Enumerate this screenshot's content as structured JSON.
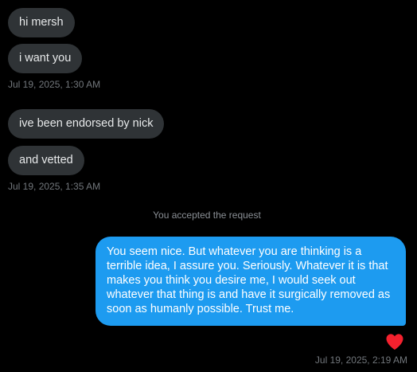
{
  "colors": {
    "background": "#000000",
    "incoming_bubble": "#2f3336",
    "outgoing_bubble": "#1d9bf0",
    "timestamp": "#71767b",
    "reaction_heart": "#f91880"
  },
  "messages": {
    "group1": {
      "msg1": "hi mersh",
      "msg2": "i want you",
      "timestamp": "Jul 19, 2025, 1:30 AM"
    },
    "group2": {
      "msg1": "ive been endorsed by nick",
      "msg2": "and vetted",
      "timestamp": "Jul 19, 2025, 1:35 AM"
    },
    "system_note": "You accepted the request",
    "reply": {
      "text": "You seem nice. But whatever you are thinking is a terrible idea, I assure you. Seriously. Whatever it is that makes you think you desire me, I would seek out whatever that thing is and have it surgically removed as soon as humanly possible. Trust me.",
      "reaction_icon": "heart-icon",
      "timestamp": "Jul 19, 2025, 2:19 AM"
    }
  }
}
